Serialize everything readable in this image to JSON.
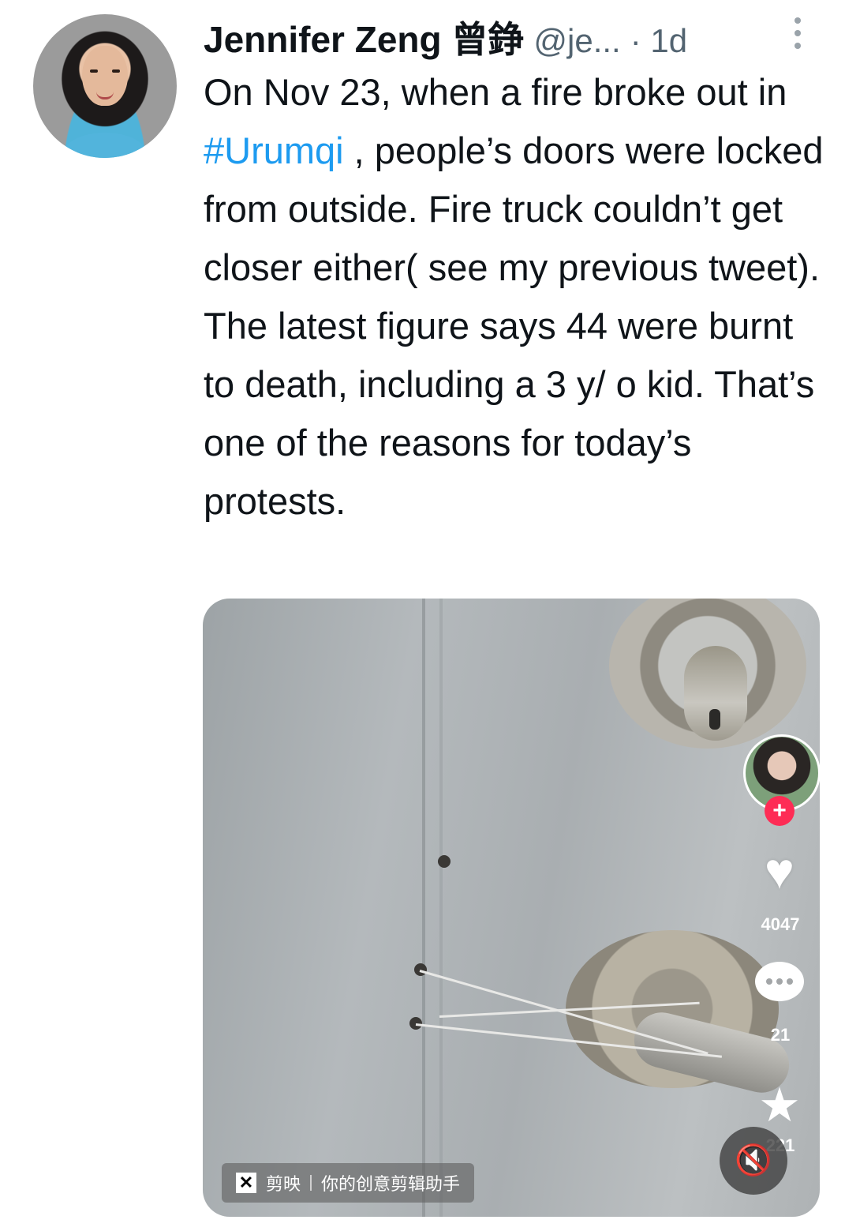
{
  "tweet": {
    "author_name": "Jennifer Zeng 曾錚",
    "handle": "@je...",
    "time": "· 1d",
    "text_before": "On Nov 23, when a fire broke out in ",
    "hashtag": "#Urumqi",
    "text_after": " , people’s doors were locked from outside. Fire truck couldn’t get closer either( see my previous tweet). The latest figure says 44 were burnt to death, including a 3 y/ o kid. That’s one of the reasons for today’s protests.",
    "more_icon": "more-vertical-icon"
  },
  "video": {
    "likes": "4047",
    "comments": "21",
    "favorites": "221",
    "follow_plus": "+",
    "heart_glyph": "♥",
    "star_glyph": "★",
    "mute_glyph": "🔇",
    "watermark_logo": "✕",
    "watermark_app": "剪映",
    "watermark_tagline": "你的创意剪辑助手"
  },
  "colors": {
    "link": "#1d9bf0",
    "secondary_text": "#536471",
    "follow_badge": "#fe2c55"
  }
}
